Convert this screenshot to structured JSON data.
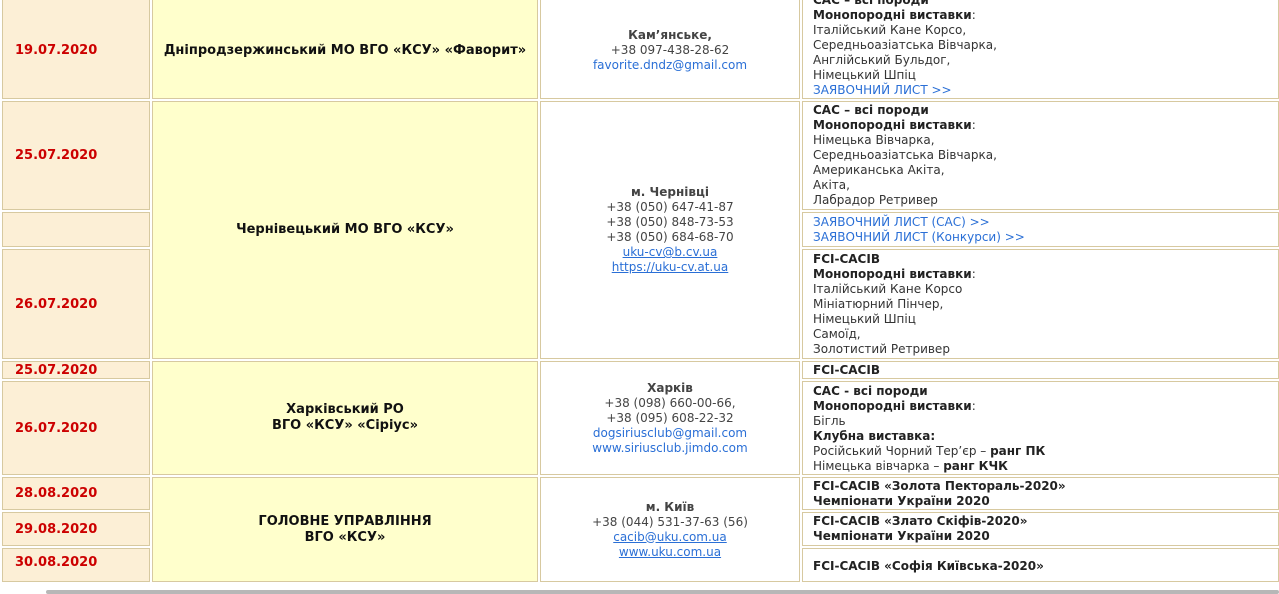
{
  "rows": {
    "favorit": {
      "date": "19.07.2020",
      "org": "Дніпродзержинський МО ВГО «КСУ» «Фаворит»",
      "city": "Кам’янське,",
      "phone": "+38 097-438-28-62",
      "email": "favorite.dndz@gmail.com",
      "info": {
        "title": "САС – всі породи",
        "mono_label": "Монопородні виставки",
        "colon": ":",
        "breeds": [
          "Італійський Кане Корсо,",
          "Середньоазіатська Вівчарка,",
          "Англійський Бульдог,",
          "Німецький Шпіц"
        ],
        "link": "ЗАЯВОЧНИЙ ЛИСТ >>"
      }
    },
    "chernivtsi": {
      "date1": "25.07.2020",
      "date2": "26.07.2020",
      "org": "Чернівецький МО ВГО «КСУ»",
      "city": "м. Чернівці",
      "phones": [
        "+38 (050) 647-41-87",
        "+38 (050) 848-73-53",
        "+38 (050) 684-68-70"
      ],
      "email": "uku-cv@b.cv.ua",
      "website": "https://uku-cv.at.ua",
      "info1": {
        "title": "САС – всі породи",
        "mono_label": "Монопородні виставки",
        "colon": ":",
        "breeds": [
          "Німецька Вівчарка,",
          "Середньоазіатська Вівчарка,",
          "Американська Акіта,",
          "Акіта,",
          "Лабрадор Ретривер"
        ]
      },
      "links": [
        "ЗАЯВОЧНИЙ ЛИСТ (САС) >>",
        "ЗАЯВОЧНИЙ ЛИСТ (Конкурси) >>"
      ],
      "info2": {
        "title": "FCI-CACIB",
        "mono_label": "Монопородні виставки",
        "colon": ":",
        "breeds": [
          "Італійський Кане Корсо",
          "Мініатюрний Пінчер,",
          "Німецький Шпіц",
          "Самоїд,",
          "Золотистий Ретривер"
        ]
      }
    },
    "kharkiv": {
      "date1": "25.07.2020",
      "date2": "26.07.2020",
      "org_line1": "Харківський РО",
      "org_line2": "ВГО «КСУ» «Сіріус»",
      "city": "Харків",
      "phones": [
        "+38 (098) 660-00-66,",
        "+38 (095) 608-22-32"
      ],
      "email": "dogsiriusclub@gmail.com",
      "website": "www.siriusclub.jimdo.com",
      "info1": "FCI-CACIB",
      "info2": {
        "title": "САС - всі породи",
        "mono_label": "Монопородні виставки",
        "colon": ":",
        "breed": "Бігль",
        "club_label": "Клубна виставка:",
        "club1_breed": "Російський Чорний Тер’єр – ",
        "club1_rank": "ранг ПК",
        "club2_breed": "Німецька вівчарка – ",
        "club2_rank": "ранг КЧК"
      }
    },
    "kyiv": {
      "date1": "28.08.2020",
      "date2": "29.08.2020",
      "date3": "30.08.2020",
      "org_line1": "ГОЛОВНЕ УПРАВЛІННЯ",
      "org_line2": "ВГО «КСУ»",
      "city": "м. Київ",
      "phone": "+38 (044) 531-37-63 (56)",
      "email": "cacib@uku.com.ua",
      "website": "www.uku.com.ua",
      "info1_line1": "FCI-CACIB «Золота Пектораль-2020»",
      "info1_line2": "Чемпіонати України 2020",
      "info2_line1": "FCI-CACIB «Злато Скіфів-2020»",
      "info2_line2": "Чемпіонати України 2020",
      "info3_line1": "FCI-CACIB «Софія Київська-2020»"
    }
  }
}
